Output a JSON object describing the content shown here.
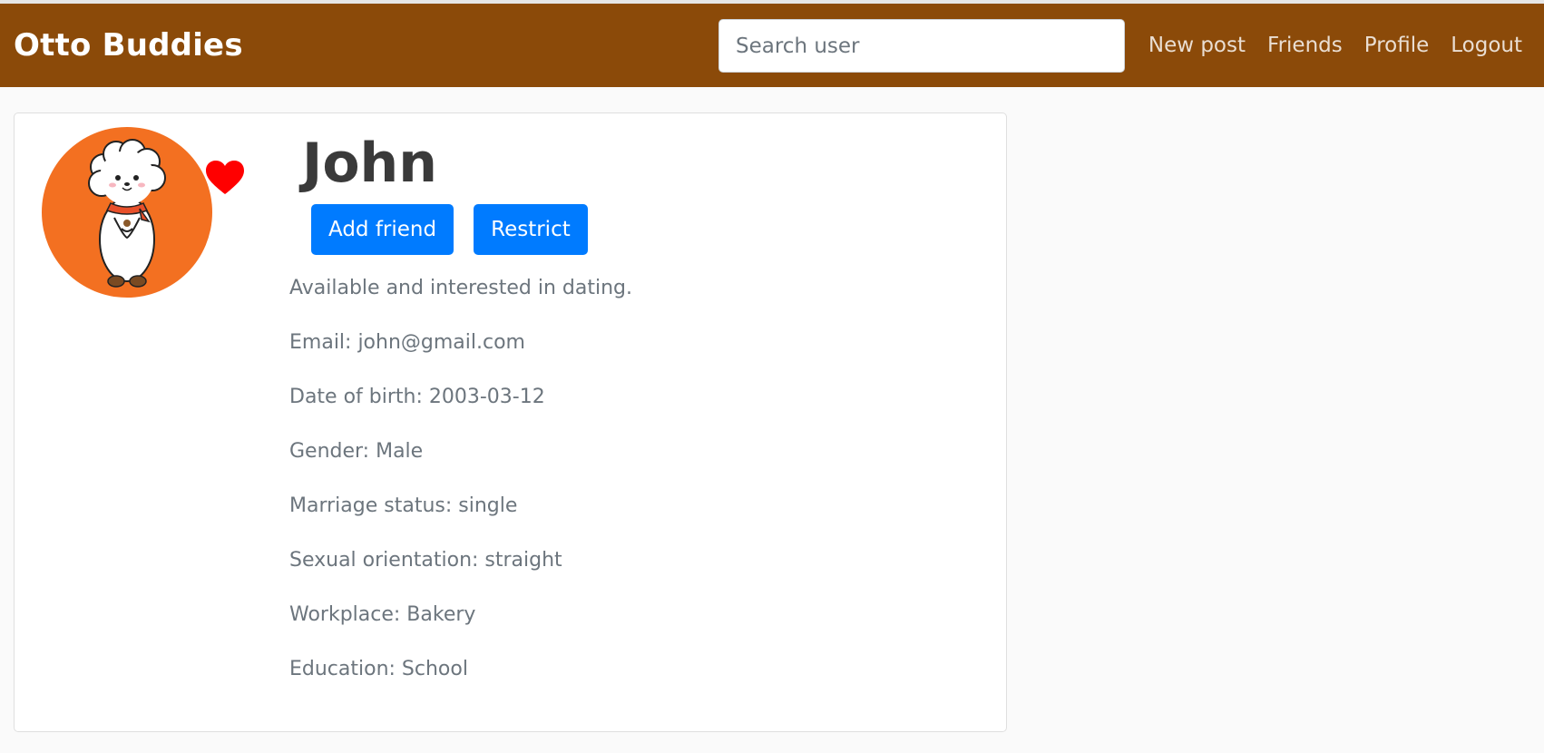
{
  "navbar": {
    "brand": "Otto Buddies",
    "search_placeholder": "Search user",
    "links": [
      "New post",
      "Friends",
      "Profile",
      "Logout"
    ],
    "background_color": "#8b4a09"
  },
  "profile": {
    "name": "John",
    "avatar_bg_color": "#f37021",
    "heart_color": "#ff0000",
    "buttons": {
      "add_friend": "Add friend",
      "restrict": "Restrict"
    },
    "details": [
      "Available and interested in dating.",
      "Email: john@gmail.com",
      "Date of birth: 2003-03-12",
      "Gender: Male",
      "Marriage status: single",
      "Sexual orientation: straight",
      "Workplace: Bakery",
      "Education: School"
    ]
  },
  "colors": {
    "primary_button": "#007bff",
    "muted_text": "#6c757d"
  }
}
